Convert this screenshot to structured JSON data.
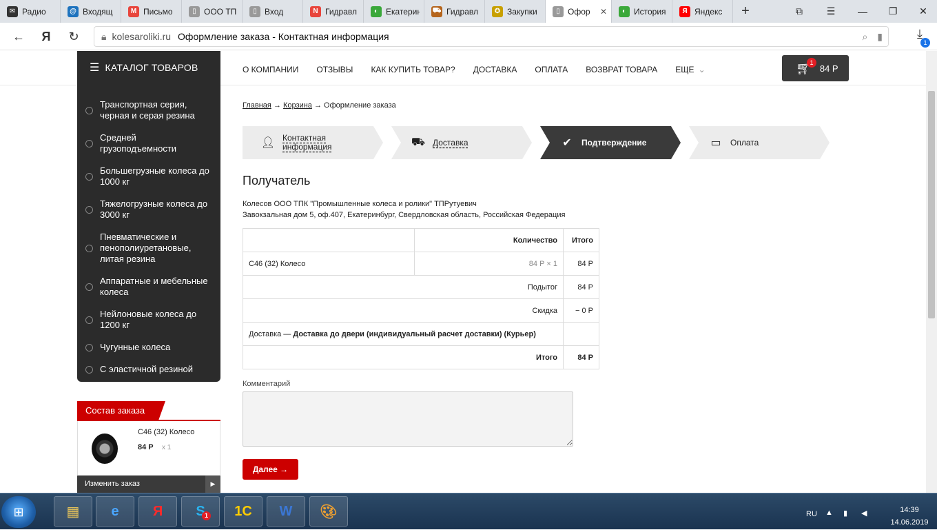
{
  "browser": {
    "tabs": [
      {
        "label": "Радио",
        "icon": "mail-icon",
        "color": "#333333",
        "glyph": "✉"
      },
      {
        "label": "Входящ",
        "icon": "at-icon",
        "color": "#1e73be",
        "glyph": "@"
      },
      {
        "label": "Письмо",
        "icon": "gmail-icon",
        "color": "#e8453c",
        "glyph": "M"
      },
      {
        "label": "ООО ТП",
        "icon": "page-icon",
        "color": "#999999",
        "glyph": "▯"
      },
      {
        "label": "Вход",
        "icon": "page-icon",
        "color": "#999999",
        "glyph": "▯"
      },
      {
        "label": "Гидравл",
        "icon": "brand-n-icon",
        "color": "#e8453c",
        "glyph": "N"
      },
      {
        "label": "Екатерин",
        "icon": "green-leaf-icon",
        "color": "#3aa83a",
        "glyph": "◐"
      },
      {
        "label": "Гидравл",
        "icon": "forklift-icon",
        "color": "#b5651d",
        "glyph": "⛟"
      },
      {
        "label": "Закупки",
        "icon": "emblem-icon",
        "color": "#c8a000",
        "glyph": "✪"
      },
      {
        "label": "Офор",
        "icon": "page-icon",
        "color": "#999999",
        "glyph": "▯",
        "active": true
      },
      {
        "label": "История",
        "icon": "green-leaf-icon",
        "color": "#3aa83a",
        "glyph": "◐"
      },
      {
        "label": "Яндекс",
        "icon": "yandex-icon",
        "color": "#ff0000",
        "glyph": "Я"
      }
    ],
    "new_tab": "+",
    "url_domain": "kolesaroliki.ru",
    "url_title": "Оформление заказа - Контактная информация",
    "downloads_count": "1"
  },
  "site": {
    "catalog_title": "КАТАЛОГ ТОВАРОВ",
    "catalog_items": [
      "Транспортная серия, черная и серая резина",
      "Средней грузоподъемности",
      "Большегрузные колеса до 1000 кг",
      "Тяжелогрузные колеса до 3000 кг",
      "Пневматические и пенополиуретановые, литая резина",
      "Аппаратные и мебельные колеса",
      "Нейлоновые колеса до 1200 кг",
      "Чугунные колеса",
      "С эластичной резиной"
    ],
    "menu": [
      "О КОМПАНИИ",
      "ОТЗЫВЫ",
      "КАК КУПИТЬ ТОВАР?",
      "ДОСТАВКА",
      "ОПЛАТА",
      "ВОЗВРАТ ТОВАРА",
      "ЕЩЕ"
    ],
    "cart_count": "1",
    "cart_total": "84 Р",
    "breadcrumb": {
      "home": "Главная",
      "cart": "Корзина",
      "current": "Оформление заказа",
      "sep": "→"
    },
    "steps": [
      {
        "label": "Контактная информация",
        "icon": "user-icon"
      },
      {
        "label": "Доставка",
        "icon": "truck-icon"
      },
      {
        "label": "Подтверждение",
        "icon": "check-icon"
      },
      {
        "label": "Оплата",
        "icon": "card-icon"
      }
    ],
    "recipient_title": "Получатель",
    "recipient_name": "Колесов ООО ТПК \"Промышленные колеса и ролики\" ТПРутуевич",
    "recipient_address": "Завокзальная дом 5, оф.407, Екатеринбург, Свердловская область, Российская Федерация",
    "table": {
      "head_qty": "Количество",
      "head_total": "Итого",
      "item_name": "С46 (32) Колесо",
      "item_qty": "84 Р × 1",
      "item_total": "84 Р",
      "subtotal_label": "Подытог",
      "subtotal_value": "84 Р",
      "discount_label": "Скидка",
      "discount_value": "− 0 Р",
      "delivery_label": "Доставка —",
      "delivery_value": "Доставка до двери (индивидуальный расчет доставки) (Курьер)",
      "total_label": "Итого",
      "total_value": "84 Р"
    },
    "comment_label": "Комментарий",
    "next_button": "Далее →",
    "summary": {
      "title": "Состав заказа",
      "product": "С46 (32) Колесо",
      "price": "84 Р",
      "qty": "x 1",
      "edit": "Изменить заказ"
    }
  },
  "taskbar": {
    "lang": "RU",
    "time": "14:39",
    "date": "14.06.2019",
    "skype_badge": "1"
  }
}
